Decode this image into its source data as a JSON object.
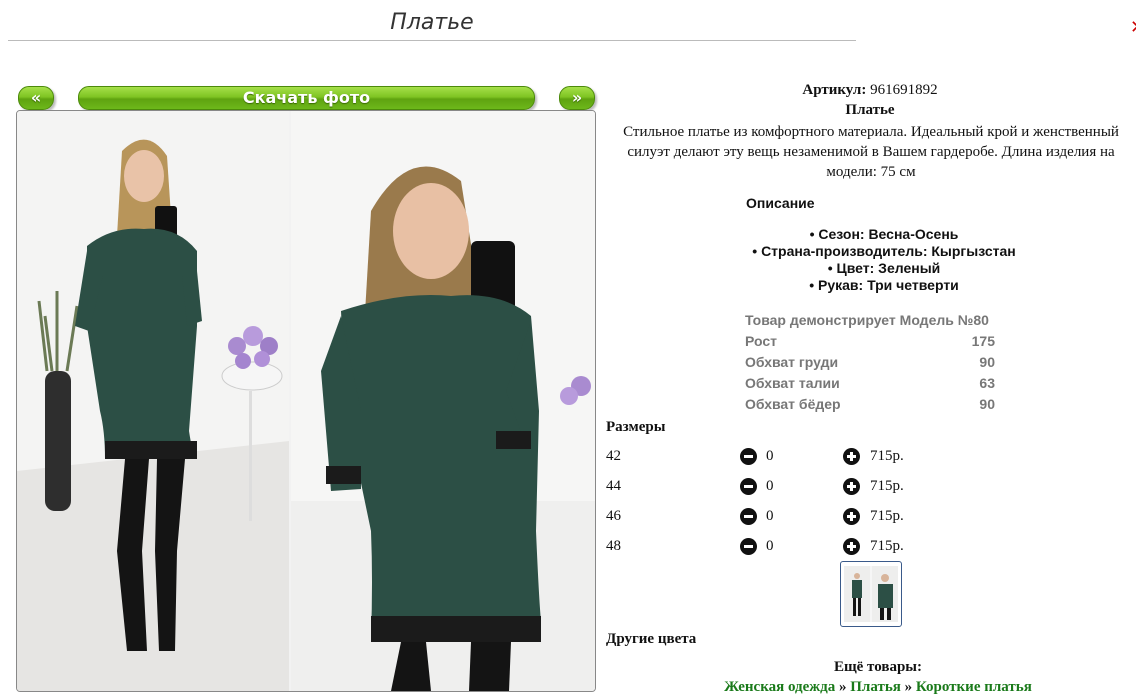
{
  "page": {
    "title": "Платье"
  },
  "gallery": {
    "prev_label": "«",
    "download_label": "Скачать фото",
    "next_label": "»"
  },
  "product": {
    "article_label": "Артикул:",
    "article_value": "961691892",
    "name": "Платье",
    "description": "Стильное платье из комфортного материала. Идеальный крой и женственный силуэт делают эту вещь незаменимой в Вашем гардеробе. Длина изделия на модели: 75 см"
  },
  "specs": {
    "title": "Описание",
    "items": [
      "• Сезон: Весна-Осень",
      "• Страна-производитель: Кыргызстан",
      "• Цвет: Зеленый",
      "• Рукав: Три четверти"
    ]
  },
  "model": {
    "heading": "Товар демонстрирует Модель №80",
    "rows": [
      {
        "label": "Рост",
        "value": "175"
      },
      {
        "label": "Обхват груди",
        "value": "90"
      },
      {
        "label": "Обхват талии",
        "value": "63"
      },
      {
        "label": "Обхват бёдер",
        "value": "90"
      }
    ]
  },
  "sizes": {
    "title": "Размеры",
    "rows": [
      {
        "size": "42",
        "qty": "0",
        "price": "715р."
      },
      {
        "size": "44",
        "qty": "0",
        "price": "715р."
      },
      {
        "size": "46",
        "qty": "0",
        "price": "715р."
      },
      {
        "size": "48",
        "qty": "0",
        "price": "715р."
      }
    ]
  },
  "other_colors_label": "Другие цвета",
  "more_goods": {
    "label": "Ещё товары:",
    "crumbs": [
      "Женская одежда",
      "Платья",
      "Короткие платья"
    ],
    "separator": " » "
  },
  "colors": {
    "dress": "#2c4f45",
    "link": "#1a7a1a",
    "button": "#7fc423"
  }
}
